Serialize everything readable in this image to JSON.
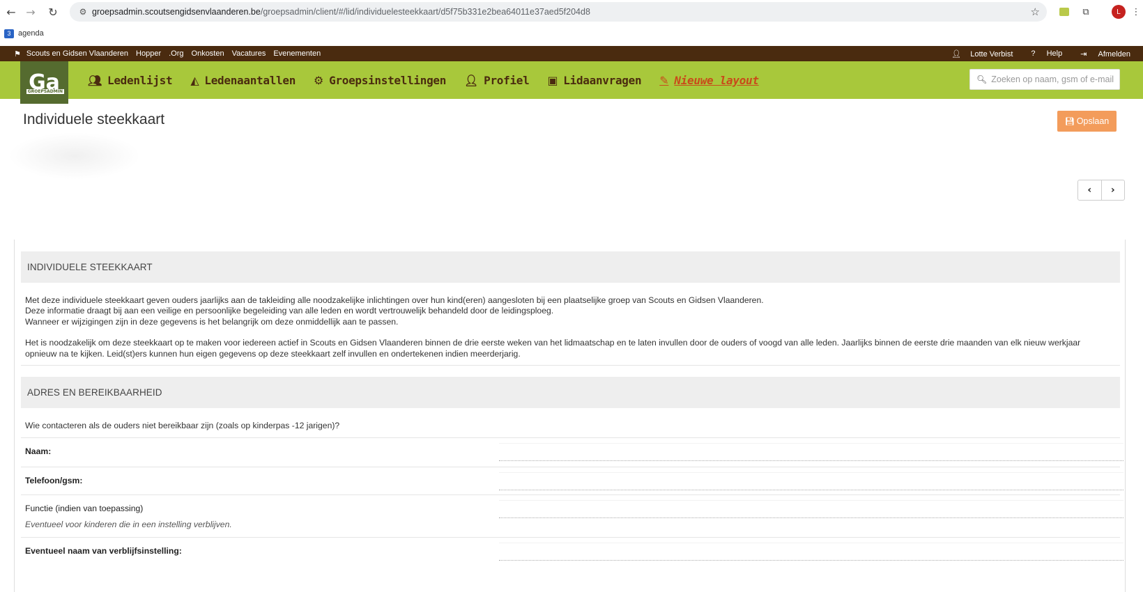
{
  "browser": {
    "url_domain": "groepsadmin.scoutsengidsenvlaanderen.be",
    "url_path": "/groepsadmin/client/#/lid/individuelesteekkaart/d5f75b331e2bea64011e37aed5f204d8",
    "bookmark": "agenda",
    "profile_initial": "L"
  },
  "topnav": {
    "items": [
      "Scouts en Gidsen Vlaanderen",
      "Hopper",
      ".Org",
      "Onkosten",
      "Vacatures",
      "Evenementen"
    ],
    "user": "Lotte Verbist",
    "help": "Help",
    "logout": "Afmelden"
  },
  "mainnav": {
    "logo": "Ga",
    "logo_sub": "GROEPSADMIN",
    "items": [
      "Ledenlijst",
      "Ledenaantallen",
      "Groepsinstellingen",
      "Profiel",
      "Lidaanvragen",
      "Nieuwe layout"
    ],
    "search_placeholder": "Zoeken op naam, gsm of e-mail"
  },
  "page": {
    "title": "Individuele steekkaart",
    "save_label": "Opslaan"
  },
  "section1": {
    "heading": "INDIVIDUELE STEEKKAART",
    "lines": [
      "Met deze individuele steekkaart geven ouders jaarlijks aan de takleiding alle noodzakelijke inlichtingen over hun kind(eren) aangesloten bij een plaatselijke groep van Scouts en Gidsen Vlaanderen.",
      "Deze informatie draagt bij aan een veilige en persoonlijke begeleiding van alle leden en wordt vertrouwelijk behandeld door de leidingsploeg.",
      "Wanneer er wijzigingen zijn in deze gegevens is het belangrijk om deze onmiddellijk aan te passen."
    ],
    "paragraph2": "Het is noodzakelijk om deze steekkaart op te maken voor iedereen actief in Scouts en Gidsen Vlaanderen binnen de drie eerste weken van het lidmaatschap en te laten invullen door de ouders of voogd van alle leden. Jaarlijks binnen de eerste drie maanden van elk nieuw werkjaar opnieuw na te kijken. Leid(st)ers kunnen hun eigen gegevens op deze steekkaart zelf invullen en ondertekenen indien meerderjarig."
  },
  "section2": {
    "heading": "ADRES EN BEREIKBAARHEID",
    "question": "Wie contacteren als de ouders niet bereikbaar zijn (zoals op kinderpas -12 jarigen)?",
    "fields": [
      {
        "label": "Naam:",
        "hint": ""
      },
      {
        "label": "Telefoon/gsm:",
        "hint": ""
      },
      {
        "label": "Functie (indien van toepassing)",
        "hint": "Eventueel voor kinderen die in een instelling verblijven."
      },
      {
        "label": "Eventueel naam van verblijfsinstelling:",
        "hint": ""
      }
    ]
  }
}
